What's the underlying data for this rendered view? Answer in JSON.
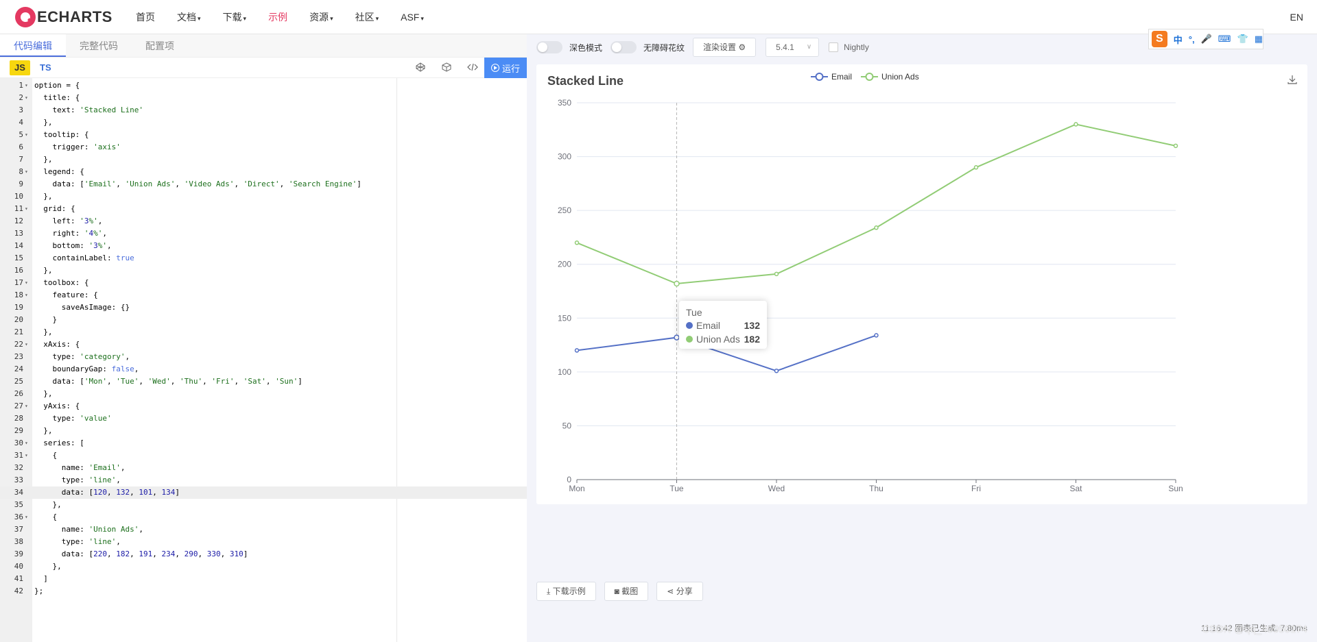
{
  "nav": {
    "logo_text": "ECHARTS",
    "items": [
      {
        "label": "首页",
        "caret": ""
      },
      {
        "label": "文档",
        "caret": "▾"
      },
      {
        "label": "下载",
        "caret": "▾"
      },
      {
        "label": "示例",
        "caret": ""
      },
      {
        "label": "资源",
        "caret": "▾"
      },
      {
        "label": "社区",
        "caret": "▾"
      },
      {
        "label": "ASF",
        "caret": "▾"
      }
    ],
    "active_item": "示例",
    "lang": "EN",
    "accent_color": "#e43961"
  },
  "editor": {
    "tabs": [
      "代码编辑",
      "完整代码",
      "配置项"
    ],
    "lang_js": "JS",
    "lang_ts": "TS",
    "run_label": "运行",
    "toolbar_icons": [
      "codepen-icon",
      "codesandbox-icon",
      "embed-code-icon"
    ],
    "active_line": 34,
    "lines": [
      {
        "n": "1",
        "f": "▾",
        "t": "option = {"
      },
      {
        "n": "2",
        "f": "▾",
        "t": "  title: {"
      },
      {
        "n": "3",
        "f": "",
        "t": "    text: 'Stacked Line'"
      },
      {
        "n": "4",
        "f": "",
        "t": "  },"
      },
      {
        "n": "5",
        "f": "▾",
        "t": "  tooltip: {"
      },
      {
        "n": "6",
        "f": "",
        "t": "    trigger: 'axis'"
      },
      {
        "n": "7",
        "f": "",
        "t": "  },"
      },
      {
        "n": "8",
        "f": "▾",
        "t": "  legend: {"
      },
      {
        "n": "9",
        "f": "",
        "t": "    data: ['Email', 'Union Ads', 'Video Ads', 'Direct', 'Search Engine']"
      },
      {
        "n": "10",
        "f": "",
        "t": "  },"
      },
      {
        "n": "11",
        "f": "▾",
        "t": "  grid: {"
      },
      {
        "n": "12",
        "f": "",
        "t": "    left: '3%',"
      },
      {
        "n": "13",
        "f": "",
        "t": "    right: '4%',"
      },
      {
        "n": "14",
        "f": "",
        "t": "    bottom: '3%',"
      },
      {
        "n": "15",
        "f": "",
        "t": "    containLabel: true"
      },
      {
        "n": "16",
        "f": "",
        "t": "  },"
      },
      {
        "n": "17",
        "f": "▾",
        "t": "  toolbox: {"
      },
      {
        "n": "18",
        "f": "▾",
        "t": "    feature: {"
      },
      {
        "n": "19",
        "f": "",
        "t": "      saveAsImage: {}"
      },
      {
        "n": "20",
        "f": "",
        "t": "    }"
      },
      {
        "n": "21",
        "f": "",
        "t": "  },"
      },
      {
        "n": "22",
        "f": "▾",
        "t": "  xAxis: {"
      },
      {
        "n": "23",
        "f": "",
        "t": "    type: 'category',"
      },
      {
        "n": "24",
        "f": "",
        "t": "    boundaryGap: false,"
      },
      {
        "n": "25",
        "f": "",
        "t": "    data: ['Mon', 'Tue', 'Wed', 'Thu', 'Fri', 'Sat', 'Sun']"
      },
      {
        "n": "26",
        "f": "",
        "t": "  },"
      },
      {
        "n": "27",
        "f": "▾",
        "t": "  yAxis: {"
      },
      {
        "n": "28",
        "f": "",
        "t": "    type: 'value'"
      },
      {
        "n": "29",
        "f": "",
        "t": "  },"
      },
      {
        "n": "30",
        "f": "▾",
        "t": "  series: ["
      },
      {
        "n": "31",
        "f": "▾",
        "t": "    {"
      },
      {
        "n": "32",
        "f": "",
        "t": "      name: 'Email',"
      },
      {
        "n": "33",
        "f": "",
        "t": "      type: 'line',"
      },
      {
        "n": "34",
        "f": "",
        "t": "      data: [120, 132, 101, 134]"
      },
      {
        "n": "35",
        "f": "",
        "t": "    },"
      },
      {
        "n": "36",
        "f": "▾",
        "t": "    {"
      },
      {
        "n": "37",
        "f": "",
        "t": "      name: 'Union Ads',"
      },
      {
        "n": "38",
        "f": "",
        "t": "      type: 'line',"
      },
      {
        "n": "39",
        "f": "",
        "t": "      data: [220, 182, 191, 234, 290, 330, 310]"
      },
      {
        "n": "40",
        "f": "",
        "t": "    },"
      },
      {
        "n": "41",
        "f": "",
        "t": "  ]"
      },
      {
        "n": "42",
        "f": "",
        "t": "};"
      }
    ]
  },
  "controls": {
    "dark_mode_label": "深色模式",
    "accessibility_label": "无障碍花纹",
    "render_settings_label": "渲染设置",
    "version": "5.4.1",
    "nightly_label": "Nightly",
    "ime": {
      "s": "S",
      "glyphs": [
        "中",
        "°,",
        "🎤",
        "⌨",
        "👕",
        "▦"
      ]
    }
  },
  "chart_data": {
    "type": "line",
    "title": "Stacked Line",
    "categories": [
      "Mon",
      "Tue",
      "Wed",
      "Thu",
      "Fri",
      "Sat",
      "Sun"
    ],
    "series": [
      {
        "name": "Email",
        "color": "#5470c6",
        "values": [
          120,
          132,
          101,
          134
        ]
      },
      {
        "name": "Union Ads",
        "color": "#91cc75",
        "values": [
          220,
          182,
          191,
          234,
          290,
          330,
          310
        ]
      }
    ],
    "ylim": [
      0,
      350
    ],
    "yticks": [
      0,
      50,
      100,
      150,
      200,
      250,
      300,
      350
    ],
    "grid": true,
    "legend_position": "top-center",
    "tooltip": {
      "category": "Tue",
      "rows": [
        {
          "name": "Email",
          "value": "132",
          "color": "#5470c6"
        },
        {
          "name": "Union Ads",
          "value": "182",
          "color": "#91cc75"
        }
      ]
    }
  },
  "bottom": {
    "download_label": "下载示例",
    "screenshot_label": "截图",
    "share_label": "分享",
    "status": "11:16:42  图表已生成, 7.80ms",
    "watermark": "CSDN @qq_40950174"
  }
}
